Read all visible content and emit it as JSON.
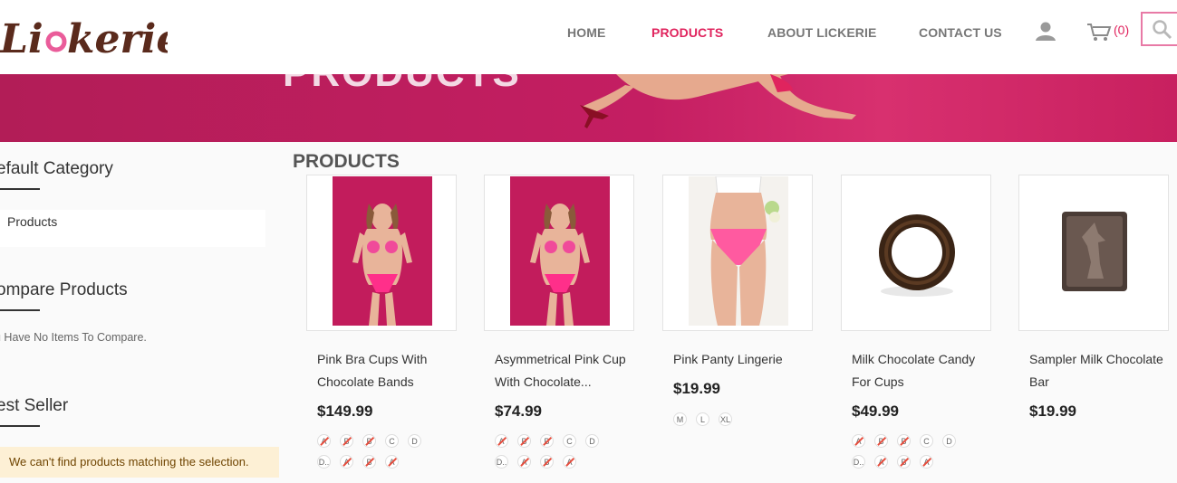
{
  "header": {
    "logo_alt": "Lickerie",
    "nav": [
      {
        "label": "HOME",
        "active": false
      },
      {
        "label": "PRODUCTS",
        "active": true
      },
      {
        "label": "ABOUT LICKERIE",
        "active": false
      },
      {
        "label": "CONTACT US",
        "active": false
      }
    ],
    "cart_count": "(0)"
  },
  "banner": {
    "title": "PRODUCTS"
  },
  "sidebar": {
    "default_category": "efault Category",
    "category_item": "Products",
    "compare_heading": "ompare Products",
    "compare_note": "u Have No Items To Compare.",
    "best_seller_heading": "est Seller",
    "warning": "We can't find products matching the selection."
  },
  "main": {
    "heading": "PRODUCTS",
    "products": [
      {
        "name": "Pink Bra Cups With Chocolate Bands",
        "price": "$149.99",
        "image": "model-pink-bra-image"
      },
      {
        "name": "Asymmetrical Pink Cup With Chocolate...",
        "price": "$74.99",
        "image": "model-pink-cup-image"
      },
      {
        "name": "Pink Panty Lingerie",
        "price": "$19.99",
        "image": "pink-panty-image"
      },
      {
        "name": "Milk Chocolate Candy For Cups",
        "price": "$49.99",
        "image": "chocolate-ring-image"
      },
      {
        "name": "Sampler Milk Chocolate Bar",
        "price": "$19.99",
        "image": "chocolate-bar-image"
      }
    ],
    "swatches_cups": [
      "A",
      "B",
      "B",
      "C",
      "D",
      "D..",
      "A",
      "B",
      "A"
    ],
    "swatches_sizes": [
      "M",
      "L",
      "XL"
    ]
  },
  "colors": {
    "accent": "#e0245e",
    "banner": "#c41e62"
  }
}
